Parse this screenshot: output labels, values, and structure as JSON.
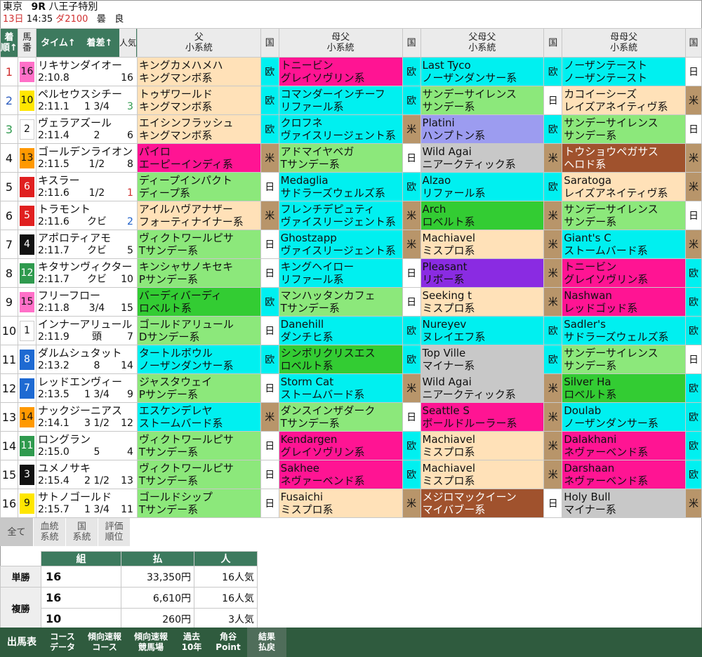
{
  "race": {
    "venue": "東京",
    "race_no": "9R",
    "race_name": "八王子特別",
    "day": "13日",
    "time": "14:35",
    "surface": "ダ2100",
    "weather": "曇",
    "going": "良"
  },
  "headers": {
    "pos": "着順↑",
    "num": "馬番",
    "time": "タイム↑",
    "margin": "着差↑",
    "pop": "人気",
    "ctry": "国",
    "sire": "父",
    "dam_sire": "母父",
    "sire_sire": "父母父",
    "dam_dam_sire": "母母父",
    "line": "小系統"
  },
  "colors": {
    "halo": "#ffe1b8",
    "north": "#00f0f0",
    "native": "#ff1493",
    "roberto": "#33cc33",
    "mrp": "#ffe1b8",
    "grey": "#c8c8c8",
    "brown": "#b8956a",
    "green": "#8ce87b",
    "purple": "#8a2be2",
    "lav": "#9c9cf0",
    "royal": "#ff66cc"
  },
  "rows": [
    {
      "pos": "1",
      "num": "16",
      "name": "リキサンダイオー",
      "time": "2:10.8",
      "margin": "",
      "pop": "16",
      "s": [
        "キングカメハメハ",
        "キングマンボ系",
        "欧"
      ],
      "d": [
        "トニービン",
        "グレイソヴリン系",
        "欧"
      ],
      "ss": [
        "Last Tyco",
        "ノーザンダンサー系",
        "欧"
      ],
      "ds": [
        "ノーザンテースト",
        "ノーザンテースト",
        "日"
      ]
    },
    {
      "pos": "2",
      "num": "10",
      "name": "ペルセウスシチー",
      "time": "2:11.1",
      "margin": "1 3/4",
      "pop": "3",
      "s": [
        "トゥザワールド",
        "キングマンボ系",
        "欧"
      ],
      "d": [
        "コマンダーインチーフ",
        "リファール系",
        "欧"
      ],
      "ss": [
        "サンデーサイレンス",
        "サンデー系",
        "日"
      ],
      "ds": [
        "カコイーシーズ",
        "レイズアネイティヴ系",
        "米"
      ]
    },
    {
      "pos": "3",
      "num": "2",
      "name": "ヴェラアズール",
      "time": "2:11.4",
      "margin": "2",
      "pop": "6",
      "s": [
        "エイシンフラッシュ",
        "キングマンボ系",
        "欧"
      ],
      "d": [
        "クロフネ",
        "ヴァイスリージェント系",
        "米"
      ],
      "ss": [
        "Platini",
        "ハンプトン系",
        "欧"
      ],
      "ds": [
        "サンデーサイレンス",
        "サンデー系",
        "日"
      ]
    },
    {
      "pos": "4",
      "num": "13",
      "name": "ゴールデンライオン",
      "time": "2:11.5",
      "margin": "1/2",
      "pop": "8",
      "s": [
        "パイロ",
        "エーピーインディ系",
        "米"
      ],
      "d": [
        "アドマイヤベガ",
        "Tサンデー系",
        "日"
      ],
      "ss": [
        "Wild Agai",
        "ニアークティック系",
        "米"
      ],
      "ds": [
        "トウショウペガサス",
        "ヘロド系",
        "米"
      ]
    },
    {
      "pos": "5",
      "num": "6",
      "name": "キスラー",
      "time": "2:11.6",
      "margin": "1/2",
      "pop": "1",
      "s": [
        "ディープインパクト",
        "ディープ系",
        "日"
      ],
      "d": [
        "Medaglia",
        "サドラーズウェルズ系",
        "欧"
      ],
      "ss": [
        "Alzao",
        "リファール系",
        "欧"
      ],
      "ds": [
        "Saratoga",
        "レイズアネイティヴ系",
        "米"
      ]
    },
    {
      "pos": "6",
      "num": "5",
      "name": "トラモント",
      "time": "2:11.6",
      "margin": "クビ",
      "pop": "2",
      "s": [
        "アイルハヴアナザー",
        "フォーティナイナー系",
        "米"
      ],
      "d": [
        "フレンチデピュティ",
        "ヴァイスリージェント系",
        "米"
      ],
      "ss": [
        "Arch",
        "ロベルト系",
        "米"
      ],
      "ds": [
        "サンデーサイレンス",
        "サンデー系",
        "日"
      ]
    },
    {
      "pos": "7",
      "num": "4",
      "name": "アポロティアモ",
      "time": "2:11.7",
      "margin": "クビ",
      "pop": "5",
      "s": [
        "ヴィクトワールピサ",
        "Tサンデー系",
        "日"
      ],
      "d": [
        "Ghostzapp",
        "ヴァイスリージェント系",
        "米"
      ],
      "ss": [
        "Machiavel",
        "ミスプロ系",
        "米"
      ],
      "ds": [
        "Giant's C",
        "ストームバード系",
        "米"
      ]
    },
    {
      "pos": "8",
      "num": "12",
      "name": "キタサンヴィクター",
      "time": "2:11.7",
      "margin": "クビ",
      "pop": "10",
      "s": [
        "キンシャサノキセキ",
        "Pサンデー系",
        "日"
      ],
      "d": [
        "キングヘイロー",
        "リファール系",
        "日"
      ],
      "ss": [
        "Pleasant",
        "リボー系",
        "米"
      ],
      "ds": [
        "トニービン",
        "グレイソヴリン系",
        "欧"
      ]
    },
    {
      "pos": "9",
      "num": "15",
      "name": "フリーフロー",
      "time": "2:11.8",
      "margin": "3/4",
      "pop": "15",
      "s": [
        "バーディバーディ",
        "ロベルト系",
        "欧"
      ],
      "d": [
        "マンハッタンカフェ",
        "Tサンデー系",
        "日"
      ],
      "ss": [
        "Seeking t",
        "ミスプロ系",
        "米"
      ],
      "ds": [
        "Nashwan",
        "レッドゴッド系",
        "欧"
      ]
    },
    {
      "pos": "10",
      "num": "1",
      "name": "インナーアリュール",
      "time": "2:11.9",
      "margin": "頭",
      "pop": "7",
      "s": [
        "ゴールドアリュール",
        "Dサンデー系",
        "日"
      ],
      "d": [
        "Danehill",
        "ダンチヒ系",
        "欧"
      ],
      "ss": [
        "Nureyev",
        "ヌレイエフ系",
        "欧"
      ],
      "ds": [
        "Sadler's",
        "サドラーズウェルズ系",
        "欧"
      ]
    },
    {
      "pos": "11",
      "num": "8",
      "name": "ダルムシュタット",
      "time": "2:13.2",
      "margin": "8",
      "pop": "14",
      "s": [
        "タートルボウル",
        "ノーザンダンサー系",
        "欧"
      ],
      "d": [
        "シンボリクリスエス",
        "ロベルト系",
        "欧"
      ],
      "ss": [
        "Top Ville",
        "マイナー系",
        "欧"
      ],
      "ds": [
        "サンデーサイレンス",
        "サンデー系",
        "日"
      ]
    },
    {
      "pos": "12",
      "num": "7",
      "name": "レッドエンヴィー",
      "time": "2:13.5",
      "margin": "1 3/4",
      "pop": "9",
      "s": [
        "ジャスタウェイ",
        "Pサンデー系",
        "日"
      ],
      "d": [
        "Storm Cat",
        "ストームバード系",
        "米"
      ],
      "ss": [
        "Wild Agai",
        "ニアークティック系",
        "米"
      ],
      "ds": [
        "Silver Ha",
        "ロベルト系",
        "欧"
      ]
    },
    {
      "pos": "13",
      "num": "14",
      "name": "ナックジーニアス",
      "time": "2:14.1",
      "margin": "3 1/2",
      "pop": "12",
      "s": [
        "エスケンデレヤ",
        "ストームバード系",
        "米"
      ],
      "d": [
        "ダンスインザダーク",
        "Tサンデー系",
        "日"
      ],
      "ss": [
        "Seattle S",
        "ボールドルーラー系",
        "米"
      ],
      "ds": [
        "Doulab",
        "ノーザンダンサー系",
        "欧"
      ]
    },
    {
      "pos": "14",
      "num": "11",
      "name": "ロングラン",
      "time": "2:15.0",
      "margin": "5",
      "pop": "4",
      "s": [
        "ヴィクトワールピサ",
        "Tサンデー系",
        "日"
      ],
      "d": [
        "Kendargen",
        "グレイソヴリン系",
        "欧"
      ],
      "ss": [
        "Machiavel",
        "ミスプロ系",
        "米"
      ],
      "ds": [
        "Dalakhani",
        "ネヴァーベンド系",
        "欧"
      ]
    },
    {
      "pos": "15",
      "num": "3",
      "name": "ユメノサキ",
      "time": "2:15.4",
      "margin": "2 1/2",
      "pop": "13",
      "s": [
        "ヴィクトワールピサ",
        "Tサンデー系",
        "日"
      ],
      "d": [
        "Sakhee",
        "ネヴァーベンド系",
        "欧"
      ],
      "ss": [
        "Machiavel",
        "ミスプロ系",
        "米"
      ],
      "ds": [
        "Darshaan",
        "ネヴァーベンド系",
        "欧"
      ]
    },
    {
      "pos": "16",
      "num": "9",
      "name": "サトノゴールド",
      "time": "2:15.7",
      "margin": "1 3/4",
      "pop": "11",
      "s": [
        "ゴールドシップ",
        "Tサンデー系",
        "日"
      ],
      "d": [
        "Fusaichi",
        "ミスプロ系",
        "米"
      ],
      "ss": [
        "メジロマックイーン",
        "マイバブー系",
        "日"
      ],
      "ds": [
        "Holy Bull",
        "マイナー系",
        "米"
      ]
    }
  ],
  "tabs": [
    "全て",
    "血統\n系統",
    "国\n系統",
    "評価\n順位"
  ],
  "payout": {
    "headers": [
      "組",
      "払",
      "人"
    ],
    "rows": [
      {
        "label": "単勝",
        "combo": "16",
        "amount": "33,350円",
        "pop": "16人気"
      },
      {
        "label": "複勝",
        "combo": "16",
        "amount": "6,610円",
        "pop": "16人気"
      },
      {
        "label": "",
        "combo": "10",
        "amount": "260円",
        "pop": "3人気"
      }
    ]
  },
  "bottom_nav": [
    "出馬表",
    "コース\nデータ",
    "傾向速報\nコース",
    "傾向速報\n競馬場",
    "過去\n10年",
    "角谷\nPoint",
    "結果\n払戻"
  ]
}
